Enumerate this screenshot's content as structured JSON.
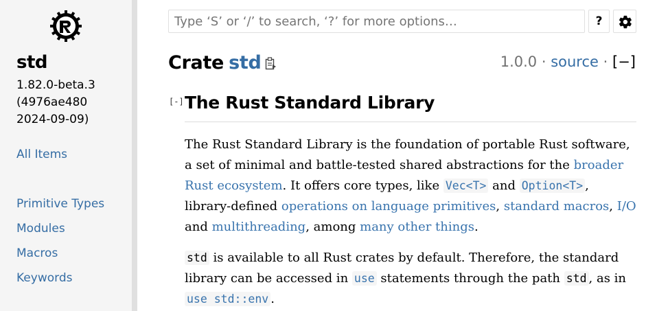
{
  "sidebar": {
    "crate_name": "std",
    "version": "1.82.0-beta.3",
    "commit": "(4976ae480",
    "date": "2024-09-09)",
    "all_items": "All Items",
    "sections": [
      "Primitive Types",
      "Modules",
      "Macros",
      "Keywords"
    ]
  },
  "search": {
    "placeholder": "Type ‘S’ or ‘/’ to search, ‘?’ for more options…",
    "help_label": "?"
  },
  "header": {
    "crate_word": "Crate",
    "crate_name": "std",
    "version": "1.0.0",
    "separator": "·",
    "source_label": "source",
    "toggle_label": "[−]"
  },
  "section": {
    "toggle": "[-]",
    "title": "The Rust Standard Library"
  },
  "para1": {
    "t1": "The Rust Standard Library is the foundation of portable Rust software, a set of minimal and battle-tested shared abstractions for the ",
    "l1": "broader Rust ecosystem",
    "t2": ". It offers core types, like ",
    "c1": "Vec<T>",
    "t3": " and ",
    "c2": "Option<T>",
    "t4": ", library-defined ",
    "l2": "operations on language primitives",
    "t5": ", ",
    "l3": "standard macros",
    "t6": ", ",
    "l4": "I/O",
    "t7": " and ",
    "l5": "multithreading",
    "t8": ", among ",
    "l6": "many other things",
    "t9": "."
  },
  "para2": {
    "c1": "std",
    "t1": " is available to all Rust crates by default. Therefore, the standard library can be accessed in ",
    "c2": "use",
    "t2": " statements through the path ",
    "c3": "std",
    "t3": ", as in ",
    "c4": "use std::env",
    "t4": "."
  },
  "colors": {
    "link": "#356da4",
    "sidebar_bg": "#f5f5f5",
    "code_bg": "#f5f5f5"
  }
}
